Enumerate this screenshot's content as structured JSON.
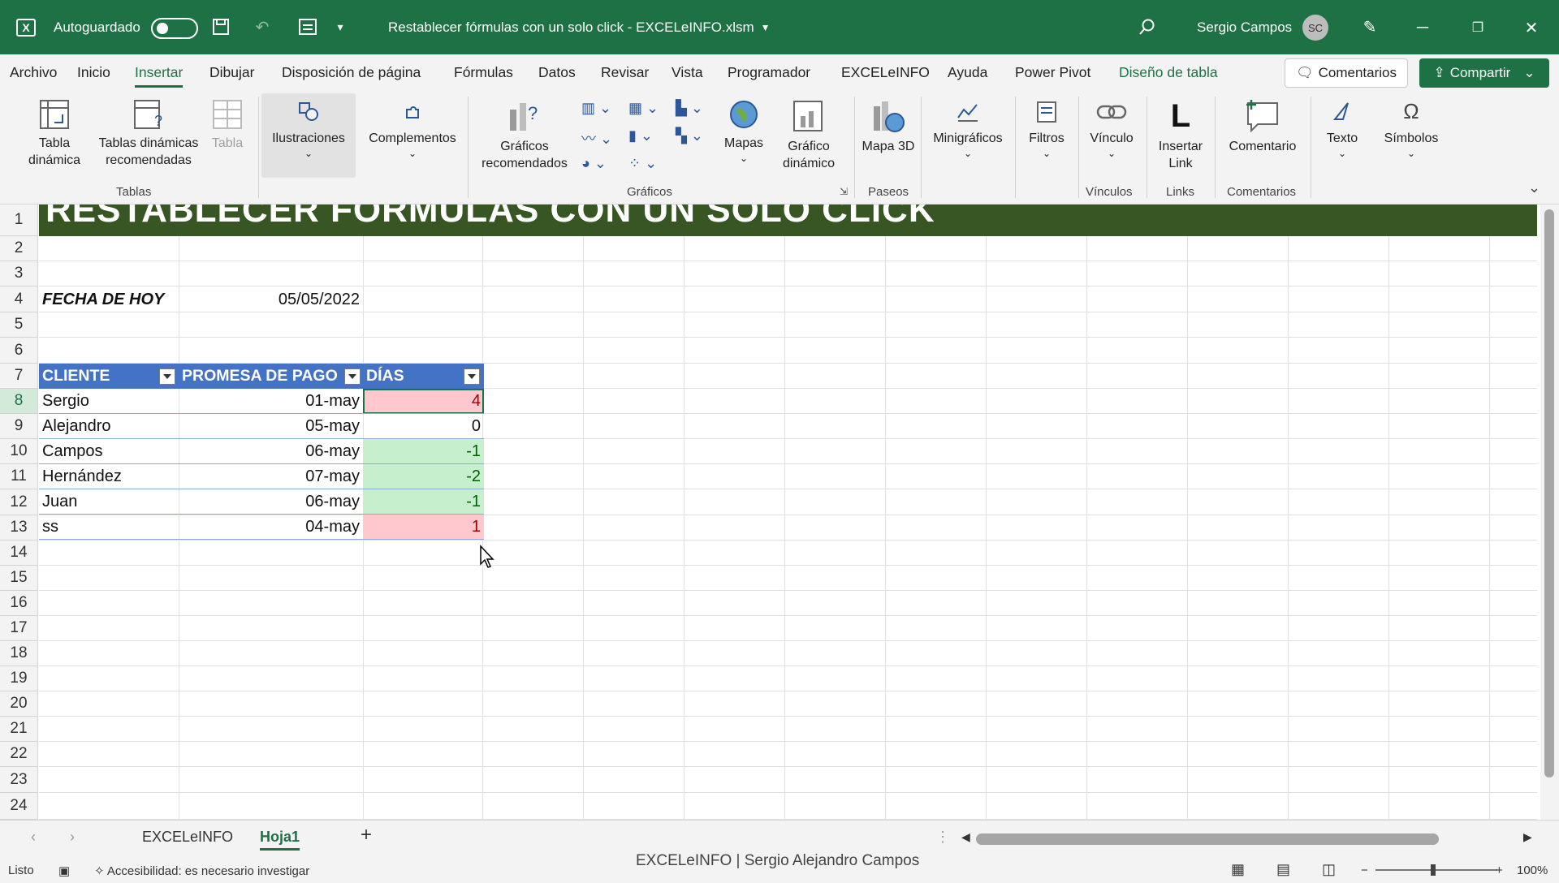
{
  "titlebar": {
    "autosave_label": "Autoguardado",
    "document_title": "Restablecer fórmulas con un solo click - EXCELeINFO.xlsm",
    "user_name": "Sergio Campos",
    "user_initials": "SC"
  },
  "menu": {
    "tabs": [
      "Archivo",
      "Inicio",
      "Insertar",
      "Dibujar",
      "Disposición de página",
      "Fórmulas",
      "Datos",
      "Revisar",
      "Vista",
      "Programador",
      "EXCELeINFO",
      "Ayuda",
      "Power Pivot",
      "Diseño de tabla"
    ],
    "active_tab": "Insertar",
    "comments_button": "Comentarios",
    "share_button": "Compartir"
  },
  "ribbon": {
    "tabla_dinamica": "Tabla dinámica",
    "tablas_recomendadas": "Tablas dinámicas recomendadas",
    "tabla": "Tabla",
    "group_tablas": "Tablas",
    "ilustraciones": "Ilustraciones",
    "complementos": "Complementos",
    "graficos_recomendados": "Gráficos recomendados",
    "mapas": "Mapas",
    "grafico_dinamico": "Gráfico dinámico",
    "group_graficos": "Gráficos",
    "mapa_3d": "Mapa 3D",
    "group_paseos": "Paseos",
    "minigraficos": "Minigráficos",
    "filtros": "Filtros",
    "vinculo": "Vínculo",
    "group_vinculos": "Vínculos",
    "insertar_link": "Insertar Link",
    "group_links": "Links",
    "comentario": "Comentario",
    "group_comentarios": "Comentarios",
    "texto": "Texto",
    "simbolos": "Símbolos"
  },
  "sheet": {
    "banner_title": "RESTABLECER FÓRMULAS CON UN SOLO CLICK",
    "row_numbers": [
      "1",
      "2",
      "3",
      "4",
      "5",
      "6",
      "7",
      "8",
      "9",
      "10",
      "11",
      "12",
      "13",
      "14",
      "15",
      "16",
      "17",
      "18",
      "19",
      "20",
      "21",
      "22",
      "23",
      "24"
    ],
    "fecha_label": "FECHA DE HOY",
    "fecha_value": "05/05/2022",
    "headers": [
      "CLIENTE",
      "PROMESA DE PAGO",
      "DÍAS"
    ],
    "rows": [
      {
        "cliente": "Sergio",
        "promesa": "01-may",
        "dias": "4",
        "status": "red"
      },
      {
        "cliente": "Alejandro",
        "promesa": "05-may",
        "dias": "0",
        "status": "none"
      },
      {
        "cliente": "Campos",
        "promesa": "06-may",
        "dias": "-1",
        "status": "green"
      },
      {
        "cliente": "Hernández",
        "promesa": "07-may",
        "dias": "-2",
        "status": "green"
      },
      {
        "cliente": "Juan",
        "promesa": "06-may",
        "dias": "-1",
        "status": "green"
      },
      {
        "cliente": "ss",
        "promesa": "04-may",
        "dias": "1",
        "status": "red"
      }
    ]
  },
  "sheet_tabs": {
    "tabs": [
      "EXCELeINFO",
      "Hoja1"
    ],
    "active": "Hoja1"
  },
  "status": {
    "ready": "Listo",
    "accessibility": "Accesibilidad: es necesario investigar",
    "watermark": "EXCELeINFO | Sergio Alejandro Campos",
    "zoom": "100%"
  },
  "colors": {
    "excel_green": "#1e7145",
    "banner_green": "#375623",
    "table_header_blue": "#4472c4",
    "bad_fill": "#ffc7ce",
    "good_fill": "#c6efce"
  }
}
